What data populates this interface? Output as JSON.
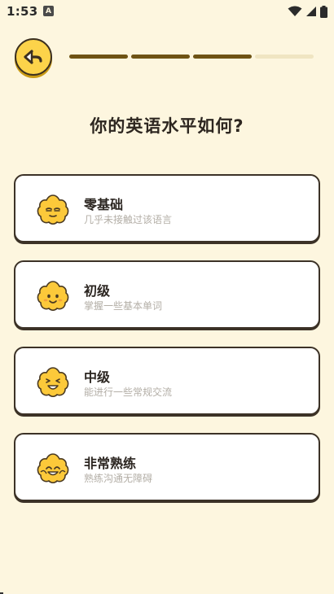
{
  "status_bar": {
    "time": "1:53",
    "app_icon_letter": "A",
    "icons": [
      "wifi-icon",
      "signal-icon",
      "battery-icon"
    ]
  },
  "header": {
    "back_icon": "back-arrow-icon",
    "progress": {
      "completed_steps": 3,
      "total_steps": 4
    }
  },
  "question": "你的英语水平如何?",
  "options": [
    {
      "label": "零基础",
      "description": "几乎未接触过该语言",
      "icon": "sleepy-face-icon"
    },
    {
      "label": "初级",
      "description": "掌握一些基本单词",
      "icon": "smiling-face-icon"
    },
    {
      "label": "中级",
      "description": "能进行一些常规交流",
      "icon": "grinning-face-icon"
    },
    {
      "label": "非常熟练",
      "description": "熟练沟通无障碍",
      "icon": "happy-face-icon"
    }
  ],
  "colors": {
    "background": "#fdf6df",
    "accent": "#fcd34a",
    "progress_done": "#6e5314",
    "progress_todo": "#f0e5c2",
    "card_border": "#3c3227"
  }
}
